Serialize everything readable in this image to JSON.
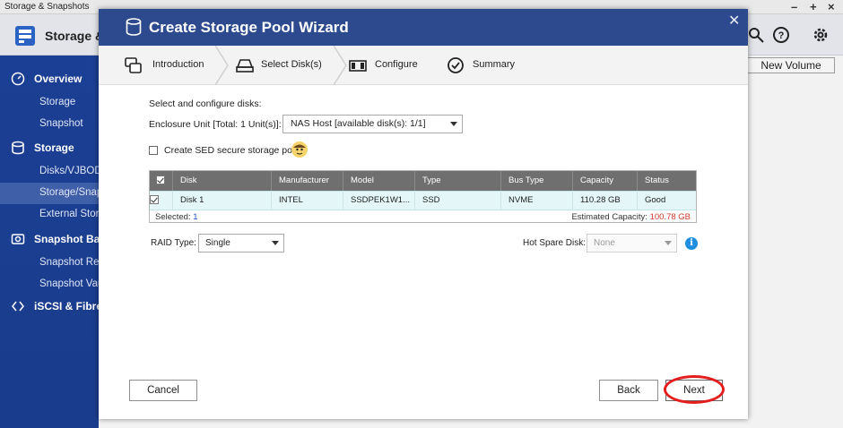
{
  "app": {
    "window_title": "Storage & Snapshots",
    "header_title": "Storage &",
    "new_volume_label": "New Volume"
  },
  "sidebar": {
    "groups": [
      {
        "label": "Overview",
        "icon": "gauge-icon"
      },
      {
        "label": "Storage",
        "icon": "database-icon"
      },
      {
        "label": "Snapshot Bac",
        "icon": "snapshot-icon"
      },
      {
        "label": "iSCSI & Fibre C",
        "icon": "share-icon"
      }
    ],
    "items": [
      {
        "label": "Storage"
      },
      {
        "label": "Snapshot"
      },
      {
        "label": "Disks/VJBOD"
      },
      {
        "label": "Storage/Snap"
      },
      {
        "label": "External Stora"
      },
      {
        "label": "Snapshot Rep"
      },
      {
        "label": "Snapshot Vau"
      }
    ]
  },
  "wizard": {
    "title": "Create Storage Pool Wizard",
    "steps": [
      {
        "label": "Introduction",
        "icon": "stack-icon"
      },
      {
        "label": "Select Disk(s)",
        "icon": "disk-icon",
        "active": true
      },
      {
        "label": "Configure",
        "icon": "raid-icon"
      },
      {
        "label": "Summary",
        "icon": "check-circle-icon"
      }
    ],
    "select_label": "Select and configure disks:",
    "enclosure_label": "Enclosure Unit [Total: 1 Unit(s)]:",
    "enclosure_value": "NAS Host [available disk(s): 1/1]",
    "sed_label": "Create SED secure storage pool",
    "table": {
      "headers": [
        "Disk",
        "Manufacturer",
        "Model",
        "Type",
        "Bus Type",
        "Capacity",
        "Status"
      ],
      "rows": [
        {
          "disk": "Disk 1",
          "manufacturer": "INTEL",
          "model": "SSDPEK1W1...",
          "type": "SSD",
          "bus_type": "NVME",
          "capacity": "110.28 GB",
          "status": "Good",
          "checked": true
        }
      ],
      "selected_label": "Selected:",
      "selected_count": "1",
      "estimated_label": "Estimated Capacity:",
      "estimated_value": "100.78 GB"
    },
    "raid_label": "RAID Type:",
    "raid_value": "Single",
    "hotspare_label": "Hot Spare Disk:",
    "hotspare_value": "None",
    "buttons": {
      "cancel": "Cancel",
      "back": "Back",
      "next": "Next"
    }
  },
  "colors": {
    "header_blue": "#2e4a8e",
    "sidebar_blue": "#1b3f94",
    "highlight_red": "#e41d1d",
    "capacity_red": "#d13a2a",
    "info_blue": "#1e8fe0"
  }
}
